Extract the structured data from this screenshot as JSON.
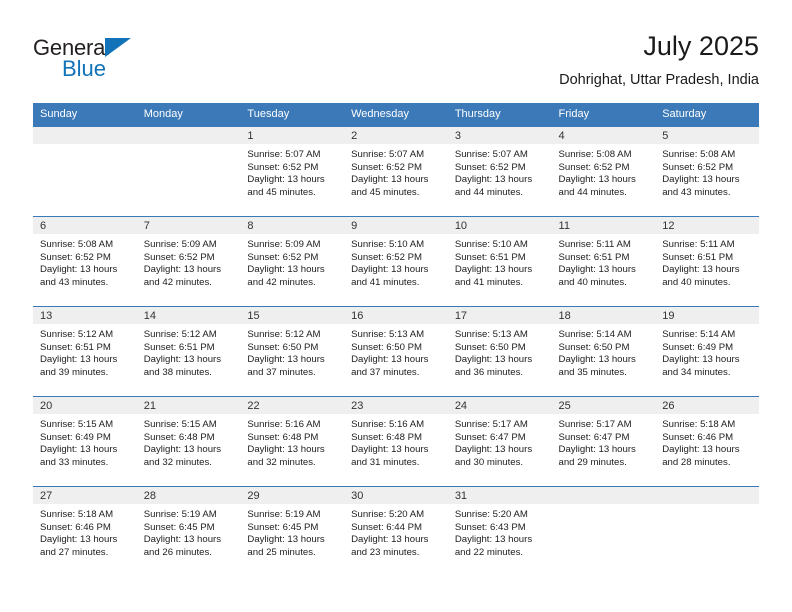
{
  "brand": {
    "name_part1": "General",
    "name_part2": "Blue",
    "triangle_color": "#1273b8",
    "text_color": "#231f20"
  },
  "header": {
    "title": "July 2025",
    "location": "Dohrighat, Uttar Pradesh, India"
  },
  "theme": {
    "header_blue": "#3b79b8",
    "daynum_band": "#efefef",
    "cell_bg": "#ffffff",
    "text": "#1d1d1d"
  },
  "weekdays": [
    "Sunday",
    "Monday",
    "Tuesday",
    "Wednesday",
    "Thursday",
    "Friday",
    "Saturday"
  ],
  "labels": {
    "sunrise": "Sunrise:",
    "sunset": "Sunset:",
    "daylight": "Daylight:"
  },
  "weeks": [
    [
      {
        "day": "",
        "sunrise": "",
        "sunset": "",
        "daylight": ""
      },
      {
        "day": "",
        "sunrise": "",
        "sunset": "",
        "daylight": ""
      },
      {
        "day": "1",
        "sunrise": "Sunrise: 5:07 AM",
        "sunset": "Sunset: 6:52 PM",
        "daylight": "Daylight: 13 hours and 45 minutes."
      },
      {
        "day": "2",
        "sunrise": "Sunrise: 5:07 AM",
        "sunset": "Sunset: 6:52 PM",
        "daylight": "Daylight: 13 hours and 45 minutes."
      },
      {
        "day": "3",
        "sunrise": "Sunrise: 5:07 AM",
        "sunset": "Sunset: 6:52 PM",
        "daylight": "Daylight: 13 hours and 44 minutes."
      },
      {
        "day": "4",
        "sunrise": "Sunrise: 5:08 AM",
        "sunset": "Sunset: 6:52 PM",
        "daylight": "Daylight: 13 hours and 44 minutes."
      },
      {
        "day": "5",
        "sunrise": "Sunrise: 5:08 AM",
        "sunset": "Sunset: 6:52 PM",
        "daylight": "Daylight: 13 hours and 43 minutes."
      }
    ],
    [
      {
        "day": "6",
        "sunrise": "Sunrise: 5:08 AM",
        "sunset": "Sunset: 6:52 PM",
        "daylight": "Daylight: 13 hours and 43 minutes."
      },
      {
        "day": "7",
        "sunrise": "Sunrise: 5:09 AM",
        "sunset": "Sunset: 6:52 PM",
        "daylight": "Daylight: 13 hours and 42 minutes."
      },
      {
        "day": "8",
        "sunrise": "Sunrise: 5:09 AM",
        "sunset": "Sunset: 6:52 PM",
        "daylight": "Daylight: 13 hours and 42 minutes."
      },
      {
        "day": "9",
        "sunrise": "Sunrise: 5:10 AM",
        "sunset": "Sunset: 6:52 PM",
        "daylight": "Daylight: 13 hours and 41 minutes."
      },
      {
        "day": "10",
        "sunrise": "Sunrise: 5:10 AM",
        "sunset": "Sunset: 6:51 PM",
        "daylight": "Daylight: 13 hours and 41 minutes."
      },
      {
        "day": "11",
        "sunrise": "Sunrise: 5:11 AM",
        "sunset": "Sunset: 6:51 PM",
        "daylight": "Daylight: 13 hours and 40 minutes."
      },
      {
        "day": "12",
        "sunrise": "Sunrise: 5:11 AM",
        "sunset": "Sunset: 6:51 PM",
        "daylight": "Daylight: 13 hours and 40 minutes."
      }
    ],
    [
      {
        "day": "13",
        "sunrise": "Sunrise: 5:12 AM",
        "sunset": "Sunset: 6:51 PM",
        "daylight": "Daylight: 13 hours and 39 minutes."
      },
      {
        "day": "14",
        "sunrise": "Sunrise: 5:12 AM",
        "sunset": "Sunset: 6:51 PM",
        "daylight": "Daylight: 13 hours and 38 minutes."
      },
      {
        "day": "15",
        "sunrise": "Sunrise: 5:12 AM",
        "sunset": "Sunset: 6:50 PM",
        "daylight": "Daylight: 13 hours and 37 minutes."
      },
      {
        "day": "16",
        "sunrise": "Sunrise: 5:13 AM",
        "sunset": "Sunset: 6:50 PM",
        "daylight": "Daylight: 13 hours and 37 minutes."
      },
      {
        "day": "17",
        "sunrise": "Sunrise: 5:13 AM",
        "sunset": "Sunset: 6:50 PM",
        "daylight": "Daylight: 13 hours and 36 minutes."
      },
      {
        "day": "18",
        "sunrise": "Sunrise: 5:14 AM",
        "sunset": "Sunset: 6:50 PM",
        "daylight": "Daylight: 13 hours and 35 minutes."
      },
      {
        "day": "19",
        "sunrise": "Sunrise: 5:14 AM",
        "sunset": "Sunset: 6:49 PM",
        "daylight": "Daylight: 13 hours and 34 minutes."
      }
    ],
    [
      {
        "day": "20",
        "sunrise": "Sunrise: 5:15 AM",
        "sunset": "Sunset: 6:49 PM",
        "daylight": "Daylight: 13 hours and 33 minutes."
      },
      {
        "day": "21",
        "sunrise": "Sunrise: 5:15 AM",
        "sunset": "Sunset: 6:48 PM",
        "daylight": "Daylight: 13 hours and 32 minutes."
      },
      {
        "day": "22",
        "sunrise": "Sunrise: 5:16 AM",
        "sunset": "Sunset: 6:48 PM",
        "daylight": "Daylight: 13 hours and 32 minutes."
      },
      {
        "day": "23",
        "sunrise": "Sunrise: 5:16 AM",
        "sunset": "Sunset: 6:48 PM",
        "daylight": "Daylight: 13 hours and 31 minutes."
      },
      {
        "day": "24",
        "sunrise": "Sunrise: 5:17 AM",
        "sunset": "Sunset: 6:47 PM",
        "daylight": "Daylight: 13 hours and 30 minutes."
      },
      {
        "day": "25",
        "sunrise": "Sunrise: 5:17 AM",
        "sunset": "Sunset: 6:47 PM",
        "daylight": "Daylight: 13 hours and 29 minutes."
      },
      {
        "day": "26",
        "sunrise": "Sunrise: 5:18 AM",
        "sunset": "Sunset: 6:46 PM",
        "daylight": "Daylight: 13 hours and 28 minutes."
      }
    ],
    [
      {
        "day": "27",
        "sunrise": "Sunrise: 5:18 AM",
        "sunset": "Sunset: 6:46 PM",
        "daylight": "Daylight: 13 hours and 27 minutes."
      },
      {
        "day": "28",
        "sunrise": "Sunrise: 5:19 AM",
        "sunset": "Sunset: 6:45 PM",
        "daylight": "Daylight: 13 hours and 26 minutes."
      },
      {
        "day": "29",
        "sunrise": "Sunrise: 5:19 AM",
        "sunset": "Sunset: 6:45 PM",
        "daylight": "Daylight: 13 hours and 25 minutes."
      },
      {
        "day": "30",
        "sunrise": "Sunrise: 5:20 AM",
        "sunset": "Sunset: 6:44 PM",
        "daylight": "Daylight: 13 hours and 23 minutes."
      },
      {
        "day": "31",
        "sunrise": "Sunrise: 5:20 AM",
        "sunset": "Sunset: 6:43 PM",
        "daylight": "Daylight: 13 hours and 22 minutes."
      },
      {
        "day": "",
        "sunrise": "",
        "sunset": "",
        "daylight": ""
      },
      {
        "day": "",
        "sunrise": "",
        "sunset": "",
        "daylight": ""
      }
    ]
  ]
}
